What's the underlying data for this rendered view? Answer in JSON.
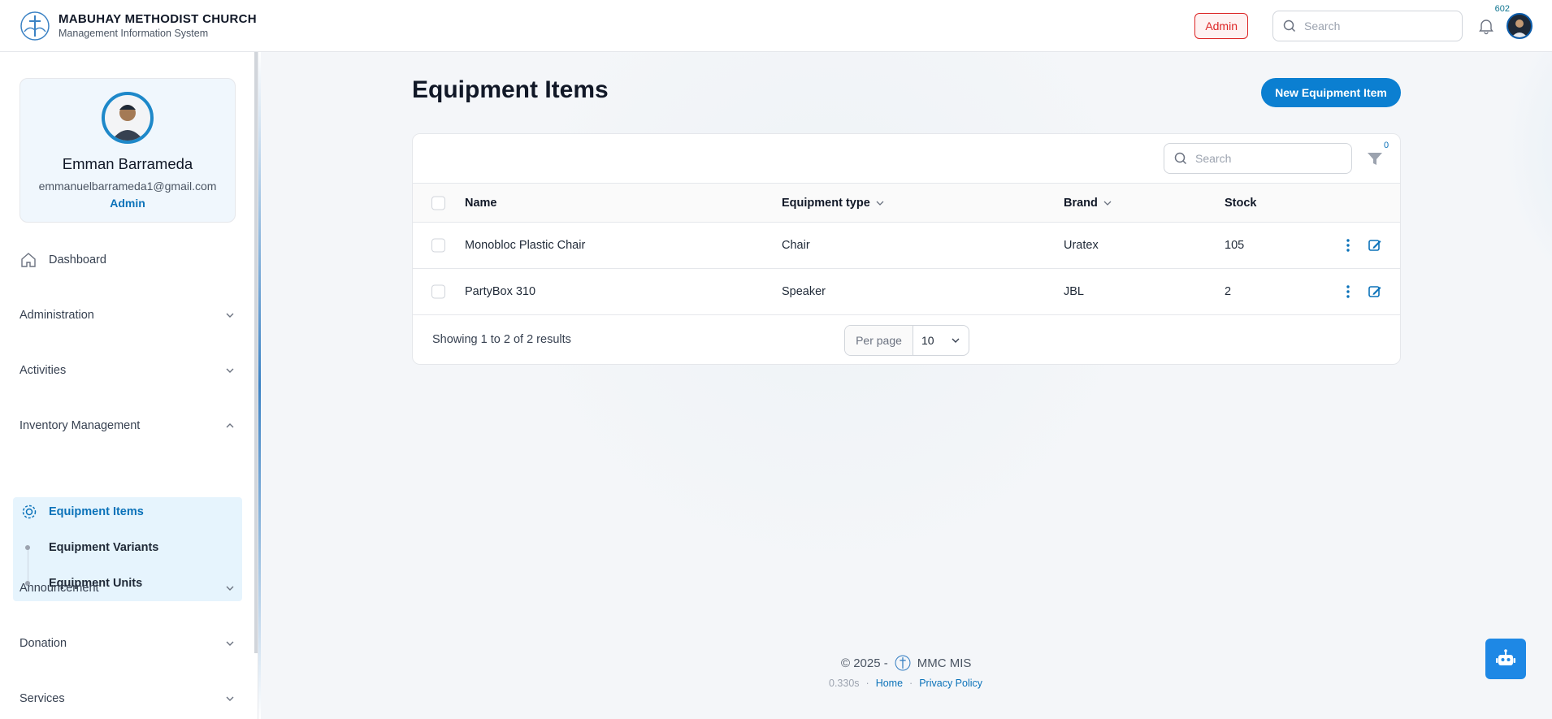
{
  "header": {
    "title": "MABUHAY METHODIST CHURCH",
    "subtitle": "Management Information System",
    "admin_badge": "Admin",
    "search_placeholder": "Search",
    "notification_count": "602"
  },
  "sidebar": {
    "profile": {
      "name": "Emman Barrameda",
      "email": "emmanuelbarrameda1@gmail.com",
      "role": "Admin"
    },
    "items": [
      {
        "label": "Dashboard",
        "icon": "home-icon"
      },
      {
        "label": "Administration",
        "icon": "chevron-down-icon"
      },
      {
        "label": "Activities",
        "icon": "chevron-down-icon"
      },
      {
        "label": "Inventory Management",
        "icon": "chevron-up-icon"
      },
      {
        "label": "Announcement",
        "icon": "chevron-down-icon"
      },
      {
        "label": "Donation",
        "icon": "chevron-down-icon"
      },
      {
        "label": "Services",
        "icon": "chevron-down-icon"
      }
    ],
    "inventory_sub": [
      {
        "label": "Equipment Items",
        "active": true
      },
      {
        "label": "Equipment Variants"
      },
      {
        "label": "Equipment Units"
      }
    ]
  },
  "main": {
    "title": "Equipment Items",
    "new_button": "New Equipment Item",
    "search_placeholder": "Search",
    "filter_count": "0",
    "columns": [
      "Name",
      "Equipment type",
      "Brand",
      "Stock"
    ],
    "rows": [
      {
        "name": "Monobloc Plastic Chair",
        "type": "Chair",
        "brand": "Uratex",
        "stock": "105"
      },
      {
        "name": "PartyBox 310",
        "type": "Speaker",
        "brand": "JBL",
        "stock": "2"
      }
    ],
    "showing": "Showing 1 to 2 of 2 results",
    "per_page_label": "Per page",
    "per_page_value": "10"
  },
  "footer": {
    "copyright": "© 2025 -",
    "app_name": "MMC MIS",
    "timing": "0.330s",
    "home_link": "Home",
    "privacy_link": "Privacy Policy",
    "sep": "·"
  },
  "colors": {
    "accent": "#0b7fd1",
    "danger": "#dc2626",
    "submenu_bg": "#e6f4fd"
  }
}
